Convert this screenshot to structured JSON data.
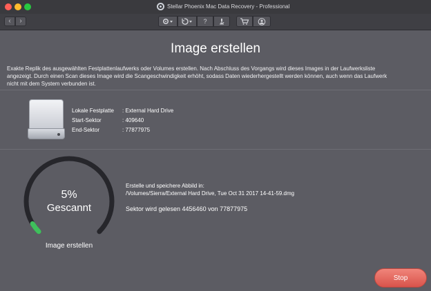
{
  "window": {
    "title": "Stellar Phoenix Mac Data Recovery - Professional"
  },
  "toolbar": {
    "back_glyph": "‹",
    "forward_glyph": "›",
    "help_glyph": "?"
  },
  "main": {
    "title": "Image erstellen",
    "description": "Exakte Replik des ausgewählten Festplattenlaufwerks oder Volumes erstellen. Nach Abschluss des Vorgangs wird dieses Images in der Laufwerksliste angezeigt. Durch einen Scan dieses Image wird die Scangeschwindigkeit erhöht, sodass Daten wiederhergestellt werden können, auch wenn das Laufwerk nicht mit dem System verbunden ist."
  },
  "drive_info": {
    "rows": [
      {
        "label": "Lokale Festplatte",
        "value": ": External Hard Drive"
      },
      {
        "label": "Start-Sektor",
        "value": ": 409640"
      },
      {
        "label": "End-Sektor",
        "value": ": 77877975"
      }
    ]
  },
  "progress": {
    "percent_text": "5%",
    "percent": 5,
    "status_word": "Gescannt",
    "caption": "Image erstellen",
    "track_color": "#26262b",
    "fill_color": "#3fbf5c"
  },
  "status": {
    "heading": "Erstelle und speichere Abbild in:",
    "path": "/Volumes/Sierra/External Hard Drive, Tue Oct 31 2017 14-41-59.dmg",
    "sector_text": "Sektor wird gelesen 4456460 von  77877975"
  },
  "actions": {
    "stop_label": "Stop",
    "stop_color": "#e06359"
  },
  "icons": [
    "app-logo-icon",
    "back-icon",
    "forward-icon",
    "gear-icon",
    "history-icon",
    "help-icon",
    "microscope-icon",
    "cart-icon",
    "account-icon",
    "hard-drive-icon"
  ]
}
